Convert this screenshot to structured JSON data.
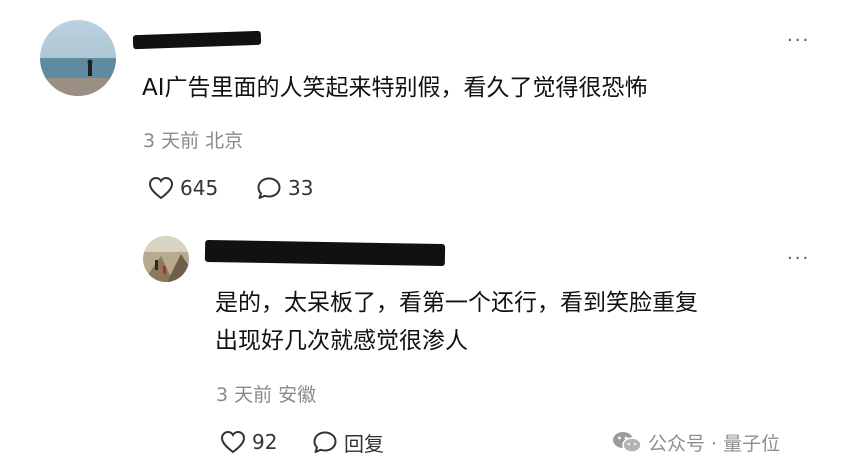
{
  "comments": [
    {
      "text": "AI广告里面的人笑起来特别假，看久了觉得很恐怖",
      "meta": "3 天前 北京",
      "likes": "645",
      "replies": "33",
      "more": "···"
    },
    {
      "text_line1": "是的，太呆板了，看第一个还行，看到笑脸重复",
      "text_line2": "出现好几次就感觉很渗人",
      "meta": "3 天前 安徽",
      "likes": "92",
      "reply_label": "回复",
      "more": "···"
    }
  ],
  "watermark": {
    "text": "公众号 · 量子位"
  },
  "icons": {
    "like": "heart-outline-icon",
    "comment": "speech-bubble-icon",
    "more": "more-dots-icon",
    "watermark": "wechat-icon"
  },
  "colors": {
    "meta_text": "#8a8a8a",
    "primary_text": "#111111",
    "redaction": "#111111"
  }
}
